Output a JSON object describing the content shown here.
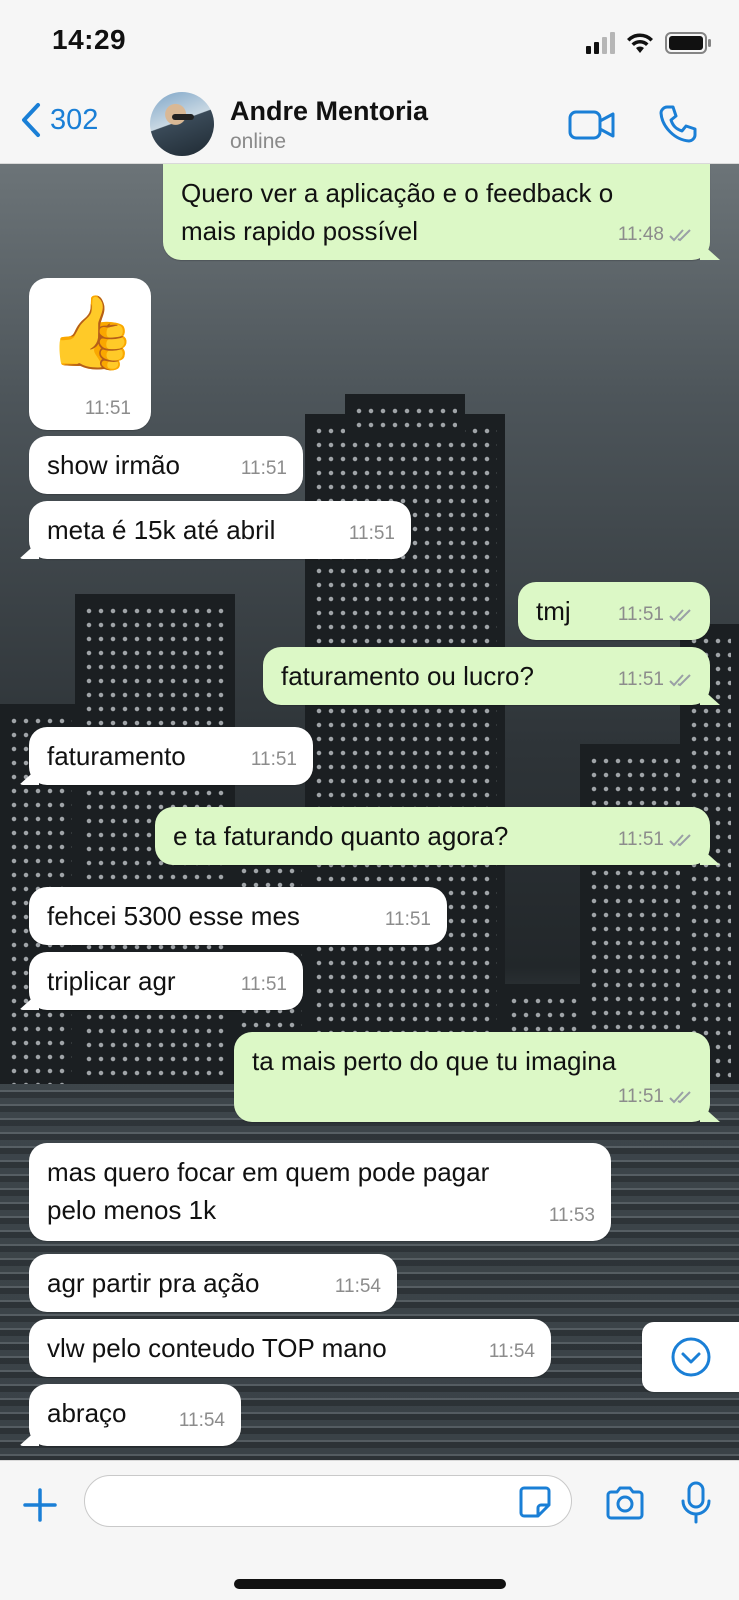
{
  "status_bar": {
    "time": "14:29"
  },
  "header": {
    "back_count": "302",
    "contact_name": "Andre Mentoria",
    "contact_status": "online"
  },
  "messages": [
    {
      "direction": "out",
      "text": "Quero ver a aplicação e o feedback o\nmais rapido possível",
      "time": "11:48",
      "read": true
    },
    {
      "direction": "in",
      "type": "sticker",
      "emoji": "👍",
      "time": "11:51"
    },
    {
      "direction": "in",
      "text": "show irmão",
      "time": "11:51"
    },
    {
      "direction": "in",
      "text": "meta é 15k até abril",
      "time": "11:51"
    },
    {
      "direction": "out",
      "text": "tmj",
      "time": "11:51",
      "read": true
    },
    {
      "direction": "out",
      "text": "faturamento ou lucro?",
      "time": "11:51",
      "read": true
    },
    {
      "direction": "in",
      "text": "faturamento",
      "time": "11:51"
    },
    {
      "direction": "out",
      "text": "e ta faturando quanto agora?",
      "time": "11:51",
      "read": true
    },
    {
      "direction": "in",
      "text": "fehcei 5300 esse mes",
      "time": "11:51"
    },
    {
      "direction": "in",
      "text": "triplicar agr",
      "time": "11:51"
    },
    {
      "direction": "out",
      "text": "ta mais perto do que tu imagina",
      "time": "11:51",
      "read": true
    },
    {
      "direction": "in",
      "text": "mas quero focar em quem pode pagar\npelo menos 1k",
      "time": "11:53"
    },
    {
      "direction": "in",
      "text": "agr partir pra ação",
      "time": "11:54"
    },
    {
      "direction": "in",
      "text": "vlw pelo conteudo TOP mano",
      "time": "11:54"
    },
    {
      "direction": "in",
      "text": "abraço",
      "time": "11:54"
    }
  ],
  "input": {
    "placeholder": ""
  },
  "icons": {
    "back": "chevron-left-icon",
    "video_call": "video-camera-icon",
    "voice_call": "phone-icon",
    "attach": "plus-icon",
    "sticker": "sticker-icon",
    "camera": "camera-icon",
    "mic": "microphone-icon",
    "scroll_down": "chevron-down-circle-icon"
  },
  "colors": {
    "accent": "#1a7fd6",
    "outgoing_bubble": "#dcf8c6",
    "incoming_bubble": "#ffffff",
    "read_ticks": "#9aa0a6"
  }
}
